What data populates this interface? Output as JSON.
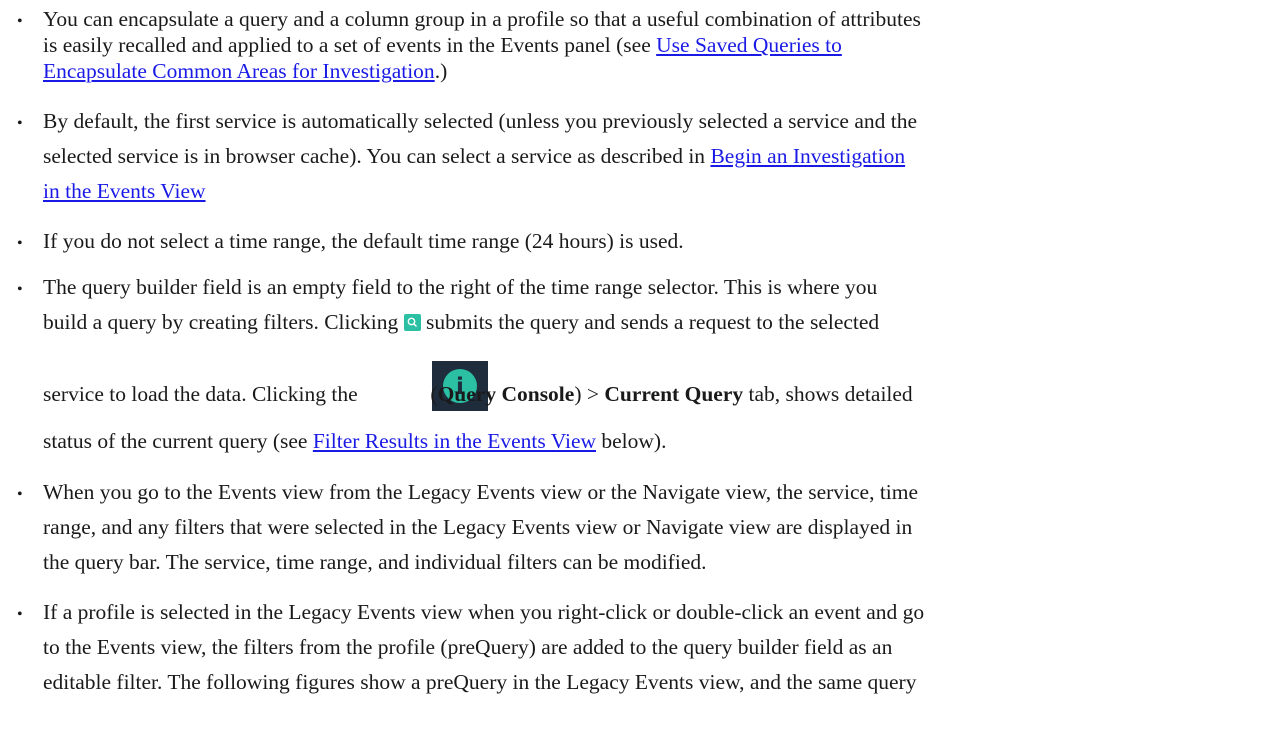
{
  "bullets": [
    {
      "lines": [
        {
          "t1": "You can encapsulate a query and a column group in a profile so that a useful combination of attributes"
        },
        {
          "t1": "is easily recalled and applied to a set of events in the Events panel (see ",
          "link": "Use Saved Queries to "
        },
        {
          "link": "Encapsulate Common Areas for Investigation",
          "t2": ".)"
        }
      ]
    },
    {
      "lines": [
        {
          "t1": "By default, the first service is automatically selected (unless you previously selected a service and the"
        },
        {
          "t1": "selected service is in browser cache). You can select a service as described in ",
          "link": "Begin an Investigation "
        },
        {
          "link": "in the Events View"
        }
      ]
    },
    {
      "lines": [
        {
          "t1": "If you do not select a time range, the default time range (24 hours) is used."
        }
      ]
    },
    {
      "lines": [
        {
          "t1": "The query builder field is an empty field to the right of the time range selector. This is where you"
        },
        {
          "t1": "build a query by creating filters. Clicking ",
          "t2": " submits the query and sends a request to the selected"
        },
        {
          "t1": "service to load the data. Clicking the ",
          "t2": " (",
          "b1": "Query Console",
          "t3": ") > ",
          "b2": "Current Query",
          "t4": " tab, shows detailed"
        },
        {
          "t1": "status of the current query (see ",
          "link": "Filter Results in the Events View",
          "t2": " below)."
        }
      ]
    },
    {
      "lines": [
        {
          "t1": "When you go to the Events view from the Legacy Events view or the Navigate view, the service, time"
        },
        {
          "t1": "range, and any filters that were selected in the Legacy Events view or Navigate view are displayed in"
        },
        {
          "t1": "the query bar. The service, time range, and individual filters can be modified."
        }
      ]
    },
    {
      "lines": [
        {
          "t1": "If a profile is selected in the Legacy Events view when you right-click or double-click an event and go"
        },
        {
          "t1": "to the Events view, the filters from the profile (preQuery) are added to the query builder field as an"
        },
        {
          "t1": "editable filter. The following figures show a preQuery in the Legacy Events view, and the same query"
        }
      ]
    }
  ],
  "icons": {
    "search": "search-icon",
    "console": "info-icon",
    "console_glyph": "i"
  }
}
